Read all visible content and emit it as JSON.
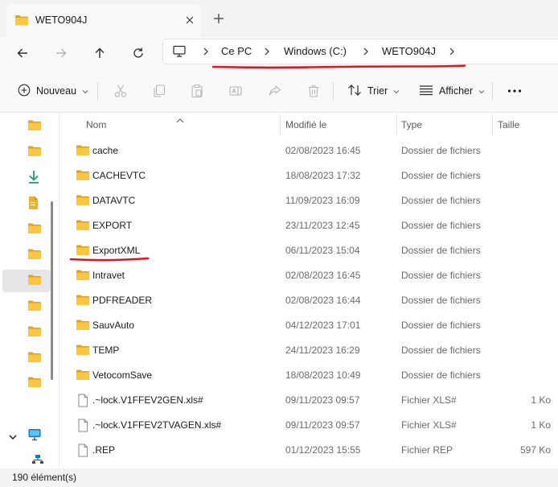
{
  "window": {
    "tab_title": "WETO904J",
    "new_tab_icon": "plus-icon",
    "close_icon": "close-icon"
  },
  "navigation": {
    "buttons": [
      "back-arrow-icon",
      "forward-arrow-icon",
      "up-arrow-icon",
      "refresh-icon"
    ],
    "breadcrumb": [
      "Ce PC",
      "Windows (C:)",
      "WETO904J"
    ],
    "root_icon": "monitor-icon"
  },
  "toolbar": {
    "new_label": "Nouveau",
    "sort_label": "Trier",
    "view_label": "Afficher",
    "icons": [
      "cut-icon",
      "copy-icon",
      "paste-icon",
      "rename-icon",
      "share-icon",
      "delete-icon",
      "more-icon"
    ]
  },
  "columns": {
    "name": "Nom",
    "modified": "Modifié le",
    "type": "Type",
    "size": "Taille"
  },
  "files": [
    {
      "name": "cache",
      "modified": "02/08/2023 16:45",
      "type": "Dossier de fichiers",
      "size": "",
      "kind": "folder"
    },
    {
      "name": "CACHEVTC",
      "modified": "18/08/2023 17:32",
      "type": "Dossier de fichiers",
      "size": "",
      "kind": "folder"
    },
    {
      "name": "DATAVTC",
      "modified": "11/09/2023 16:09",
      "type": "Dossier de fichiers",
      "size": "",
      "kind": "folder"
    },
    {
      "name": "EXPORT",
      "modified": "23/11/2023 12:45",
      "type": "Dossier de fichiers",
      "size": "",
      "kind": "folder"
    },
    {
      "name": "ExportXML",
      "modified": "06/11/2023 15:04",
      "type": "Dossier de fichiers",
      "size": "",
      "kind": "folder"
    },
    {
      "name": "Intravet",
      "modified": "02/08/2023 16:45",
      "type": "Dossier de fichiers",
      "size": "",
      "kind": "folder"
    },
    {
      "name": "PDFREADER",
      "modified": "02/08/2023 16:44",
      "type": "Dossier de fichiers",
      "size": "",
      "kind": "folder"
    },
    {
      "name": "SauvAuto",
      "modified": "04/12/2023 17:01",
      "type": "Dossier de fichiers",
      "size": "",
      "kind": "folder"
    },
    {
      "name": "TEMP",
      "modified": "24/11/2023 16:29",
      "type": "Dossier de fichiers",
      "size": "",
      "kind": "folder"
    },
    {
      "name": "VetocomSave",
      "modified": "18/08/2023 10:49",
      "type": "Dossier de fichiers",
      "size": "",
      "kind": "folder"
    },
    {
      "name": ".~lock.V1FFEV2GEN.xls#",
      "modified": "09/11/2023 09:57",
      "type": "Fichier XLS#",
      "size": "1 Ko",
      "kind": "file"
    },
    {
      "name": ".~lock.V1FFEV2TVAGEN.xls#",
      "modified": "09/11/2023 09:57",
      "type": "Fichier XLS#",
      "size": "1 Ko",
      "kind": "file"
    },
    {
      "name": ".REP",
      "modified": "01/12/2023 15:55",
      "type": "Fichier REP",
      "size": "597 Ko",
      "kind": "file"
    }
  ],
  "sidebar": {
    "items": [
      "folder-icon",
      "folder-icon",
      "download-icon",
      "document-icon",
      "folder-icon",
      "folder-icon",
      "folder-icon",
      "folder-icon",
      "folder-icon",
      "folder-icon",
      "folder-icon",
      "folder-icon"
    ],
    "selected_index": 6,
    "expander_icon": "chevron-down-icon",
    "bottom_icons": [
      "monitor-icon",
      "network-icon"
    ]
  },
  "status": {
    "item_count": "190 élément(s)"
  },
  "annotations": {
    "underline_color": "#e0141e"
  },
  "colors": {
    "folder": "#f8c640",
    "folder_dark": "#e0a21c",
    "download": "#1f9e75",
    "monitor": "#0a7bd1"
  }
}
